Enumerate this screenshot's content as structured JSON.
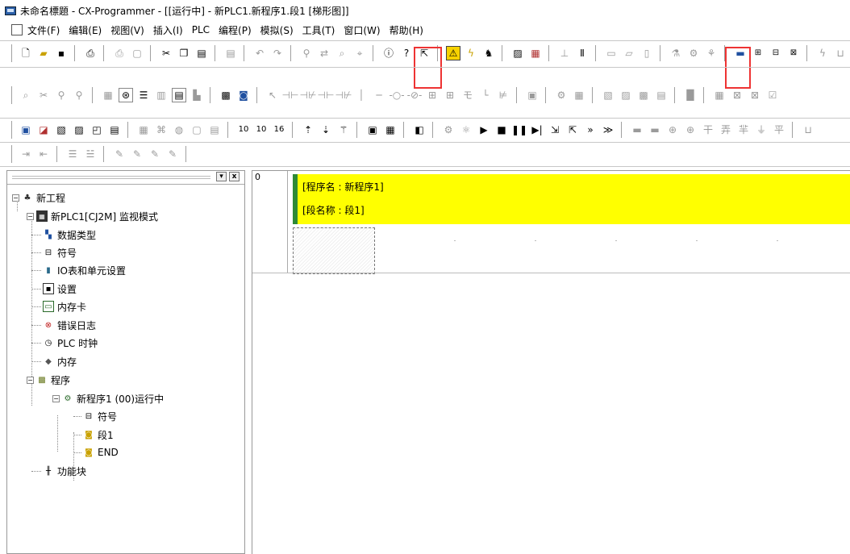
{
  "window": {
    "title": "未命名標題 - CX-Programmer - [[运行中] - 新PLC1.新程序1.段1 [梯形图]]"
  },
  "menu": [
    "文件(F)",
    "编辑(E)",
    "视图(V)",
    "插入(I)",
    "PLC",
    "编程(P)",
    "模拟(S)",
    "工具(T)",
    "窗口(W)",
    "帮助(H)"
  ],
  "toolbar_icons": {
    "row1": [
      "new-file",
      "open-folder",
      "save",
      "print-preview",
      "print",
      "preview",
      "cut",
      "copy",
      "paste",
      "paste-special",
      "undo",
      "redo",
      "find",
      "replace",
      "find-replace",
      "address-ref",
      "info",
      "help",
      "context-help",
      "online-work-mode",
      "toggle-bit",
      "force-set",
      "force-reset",
      "monitor-mode",
      "monitor",
      "stop-monitor",
      "compare",
      "transfer-to-plc",
      "transfer-from-plc",
      "program-check",
      "compile",
      "monitor-plc",
      "monitor-in-grid",
      "monitor-ladder-highlighted",
      "monitor-ladder-2",
      "differential-monitor",
      "time-chart",
      "bit-set",
      "bit-reset"
    ],
    "row2": [
      "select-mode",
      "zoom-tool",
      "zoom-in",
      "zoom-out",
      "grid",
      "show-symbols",
      "list",
      "mnemonic",
      "ladder",
      "ladder-tree",
      "io-comments",
      "cross-ref",
      "pointer",
      "contact-no",
      "contact-nc",
      "contact-or-no",
      "contact-or-nc",
      "vertical-line",
      "horizontal-line",
      "coil",
      "coil-nc",
      "instruction",
      "block",
      "function-block",
      "line-draw",
      "delete-line",
      "stmt",
      "properties",
      "output-window",
      "watch",
      "address-ref-window",
      "cross-ref-window",
      "io-table",
      "jump-rung",
      "run-rung",
      "step-rung",
      "break-rung"
    ],
    "row3": [
      "project-window",
      "rung",
      "sim-1",
      "sim-2",
      "sim-3",
      "sim-4",
      "sim-5",
      "sim-6",
      "sim-7",
      "sim-8",
      "sim-9",
      "counter-10",
      "counter-10b",
      "counter-16",
      "rung-up",
      "rung-down",
      "memory",
      "mem-2",
      "mem-3",
      "mem-4",
      "sim-start",
      "sim-settings",
      "play",
      "stop",
      "pause",
      "step-into",
      "step-over",
      "step-out",
      "continue",
      "run-to",
      "sim-io-1",
      "sim-io-2",
      "sim-io-3",
      "sim-io-4",
      "sim-io-5",
      "sim-io-6",
      "sim-io-7",
      "sim-io-8",
      "sim-io-9"
    ],
    "row4": [
      "indent",
      "outdent",
      "align-left",
      "align-center",
      "comment",
      "uncomment",
      "bookmark",
      "clear-bookmark"
    ]
  },
  "tree": {
    "root": "新工程",
    "plc": "新PLC1[CJ2M] 监视模式",
    "items": [
      "数据类型",
      "符号",
      "IO表和单元设置",
      "设置",
      "内存卡",
      "错误日志",
      "PLC 时钟",
      "内存",
      "程序"
    ],
    "program": "新程序1 (00)运行中",
    "program_children": [
      "符号",
      "段1",
      "END"
    ],
    "function_block": "功能块"
  },
  "editor": {
    "row_number": "0",
    "program_name_line": "[程序名 : 新程序1]",
    "section_name_line": "[段名称 : 段1]"
  },
  "colors": {
    "highlight_band": "#ffff00",
    "rung_bar": "#2f8a35",
    "annotation_box": "#e33333"
  }
}
